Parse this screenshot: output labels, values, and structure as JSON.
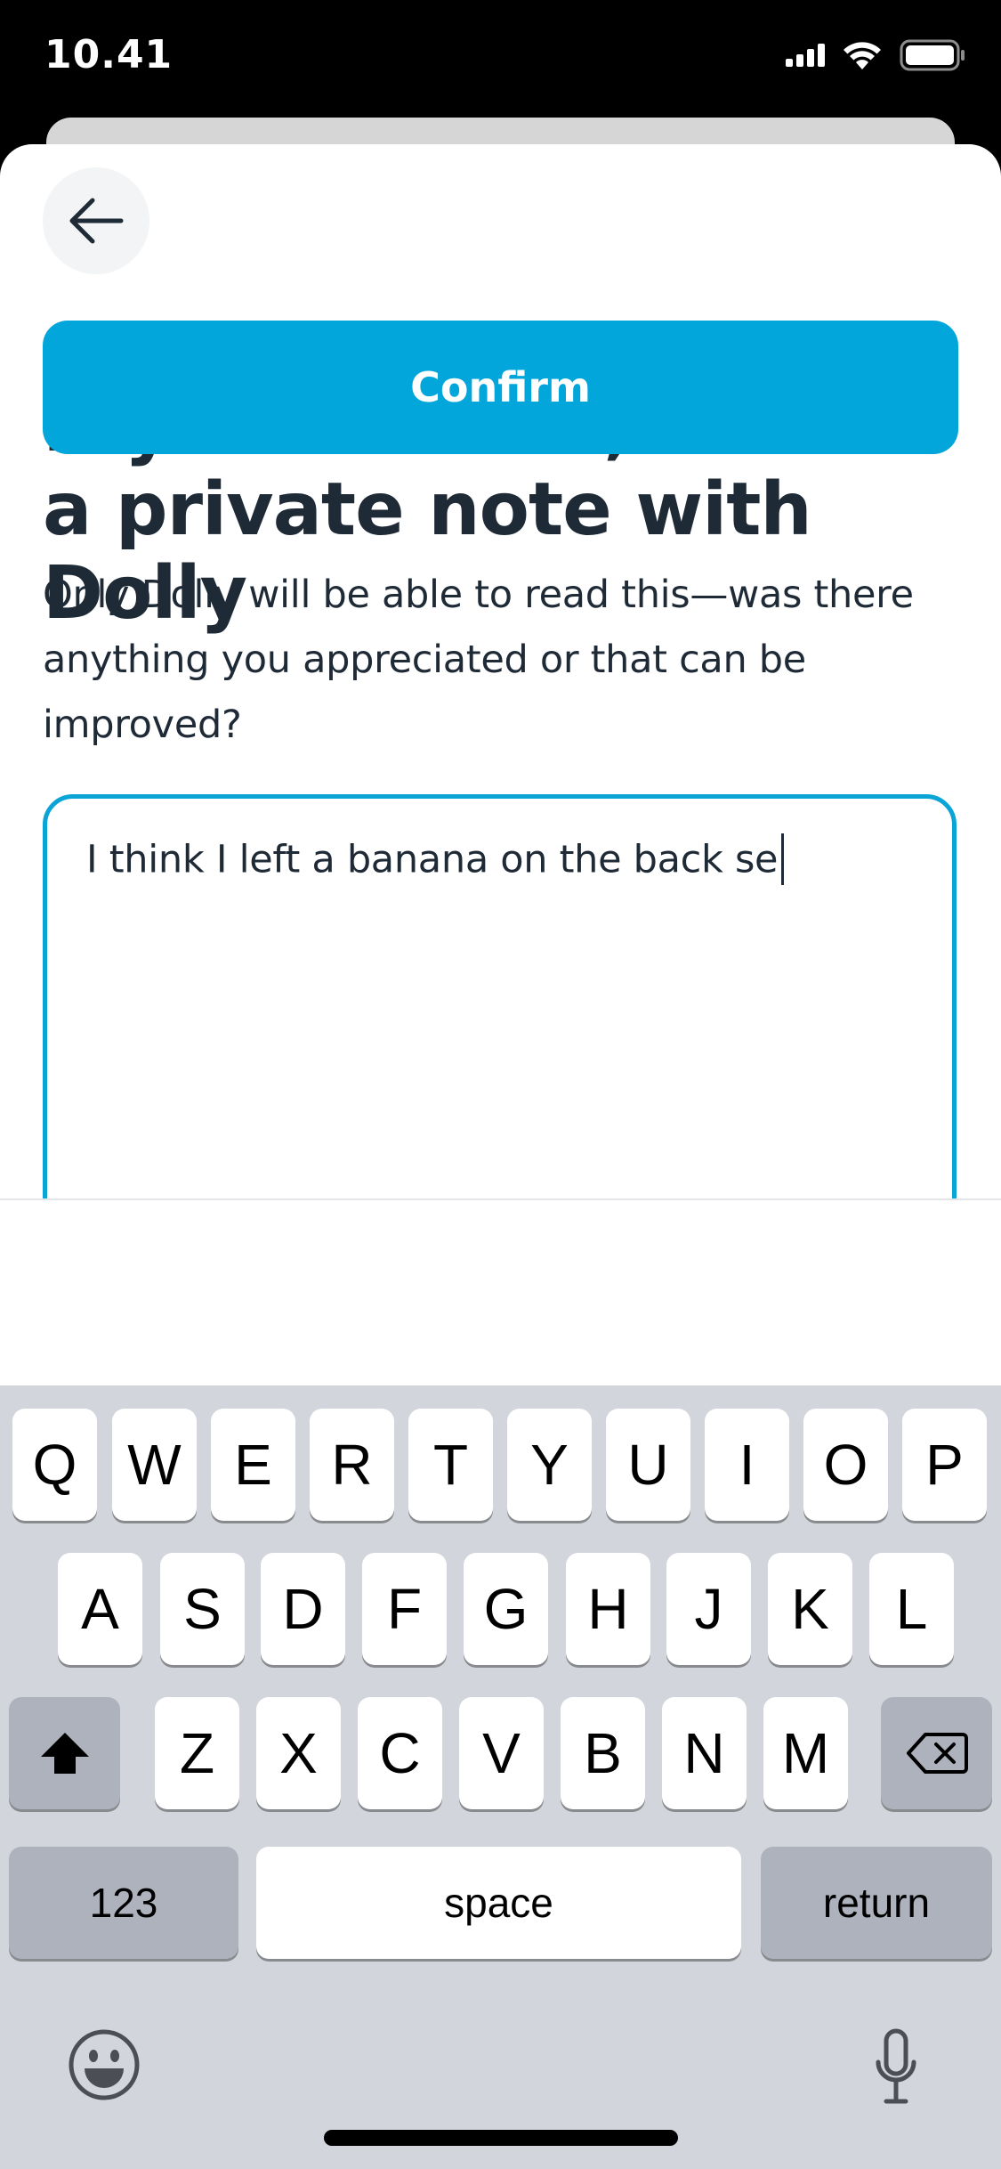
{
  "status_bar": {
    "time": "10.41",
    "signal_icon": "cellular-signal-icon",
    "wifi_icon": "wifi-icon",
    "battery_icon": "battery-icon"
  },
  "header": {
    "back_icon": "arrow-left-icon"
  },
  "content": {
    "title": "If you want to, share a private note with Dolly",
    "subtitle": "Only Dolly will be able to read this—was there anything you appreciated or that can be improved?",
    "note_value": "I think I left a banana on the back se"
  },
  "footer": {
    "confirm_label": "Confirm",
    "accent_color": "#02a6db"
  },
  "keyboard": {
    "row1": [
      "Q",
      "W",
      "E",
      "R",
      "T",
      "Y",
      "U",
      "I",
      "O",
      "P"
    ],
    "row2": [
      "A",
      "S",
      "D",
      "F",
      "G",
      "H",
      "J",
      "K",
      "L"
    ],
    "row3": [
      "Z",
      "X",
      "C",
      "V",
      "B",
      "N",
      "M"
    ],
    "numbers_label": "123",
    "space_label": "space",
    "return_label": "return",
    "shift_icon": "shift-icon",
    "delete_icon": "delete-icon",
    "emoji_icon": "emoji-icon",
    "mic_icon": "microphone-icon"
  }
}
